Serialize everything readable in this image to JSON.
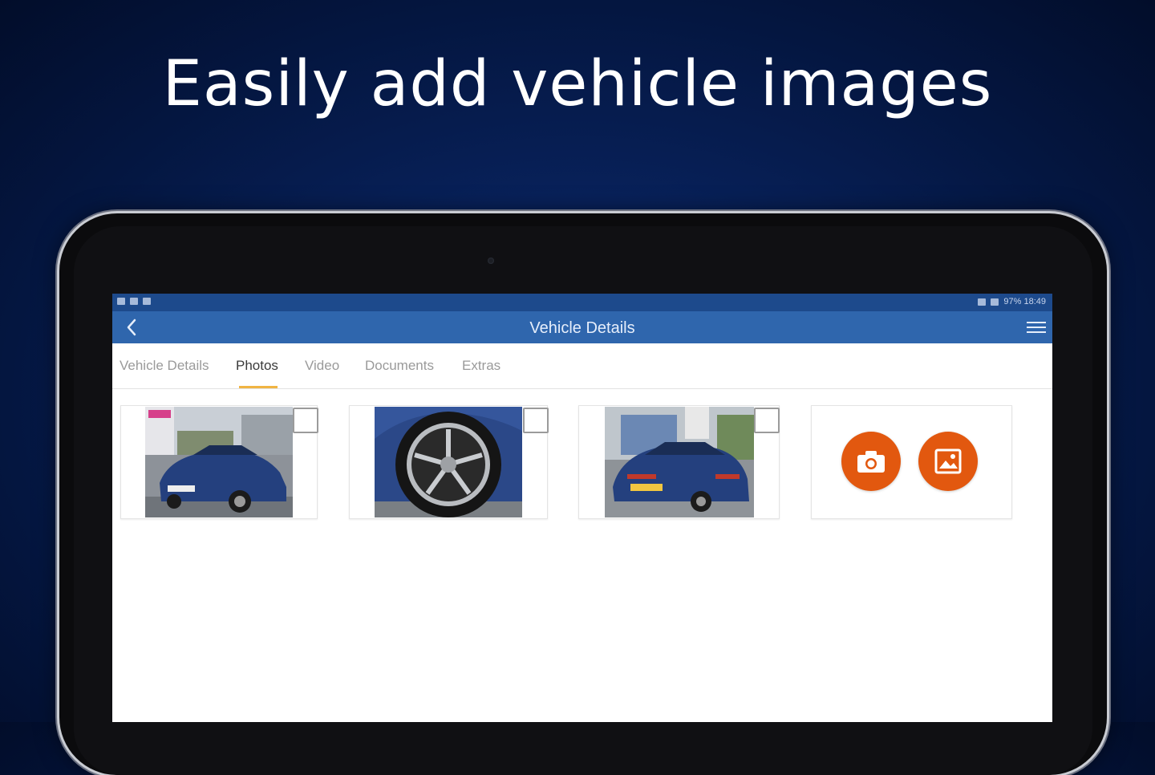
{
  "headline": "Easily add vehicle images",
  "status_bar": {
    "right_text": "97% 18:49"
  },
  "app_bar": {
    "title": "Vehicle Details",
    "back_icon": "chevron-left-icon",
    "menu_icon": "hamburger-menu-icon"
  },
  "tabs": [
    {
      "label": "Vehicle Details",
      "active": false
    },
    {
      "label": "Photos",
      "active": true
    },
    {
      "label": "Video",
      "active": false
    },
    {
      "label": "Documents",
      "active": false
    },
    {
      "label": "Extras",
      "active": false
    }
  ],
  "photos": [
    {
      "description_icon": "car-front-photo",
      "selected": false
    },
    {
      "description_icon": "car-wheel-photo",
      "selected": false
    },
    {
      "description_icon": "car-rear-photo",
      "selected": false
    }
  ],
  "add_photo": {
    "camera_icon": "camera-icon",
    "gallery_icon": "image-gallery-icon"
  },
  "colors": {
    "app_bar": "#2f66ad",
    "status_bar": "#1d4a8c",
    "tab_indicator": "#f0b443",
    "action_orange": "#e2580f",
    "car_blue": "#24407e"
  }
}
